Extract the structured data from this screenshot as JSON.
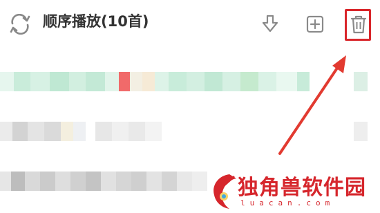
{
  "header": {
    "title": "顺序播放(10首)",
    "icons": [
      "loop-icon",
      "download-icon",
      "add-icon",
      "trash-icon"
    ]
  },
  "highlight_color": "#d9262b",
  "watermark": {
    "text": "独角兽软件园",
    "url": "luacan.com"
  }
}
